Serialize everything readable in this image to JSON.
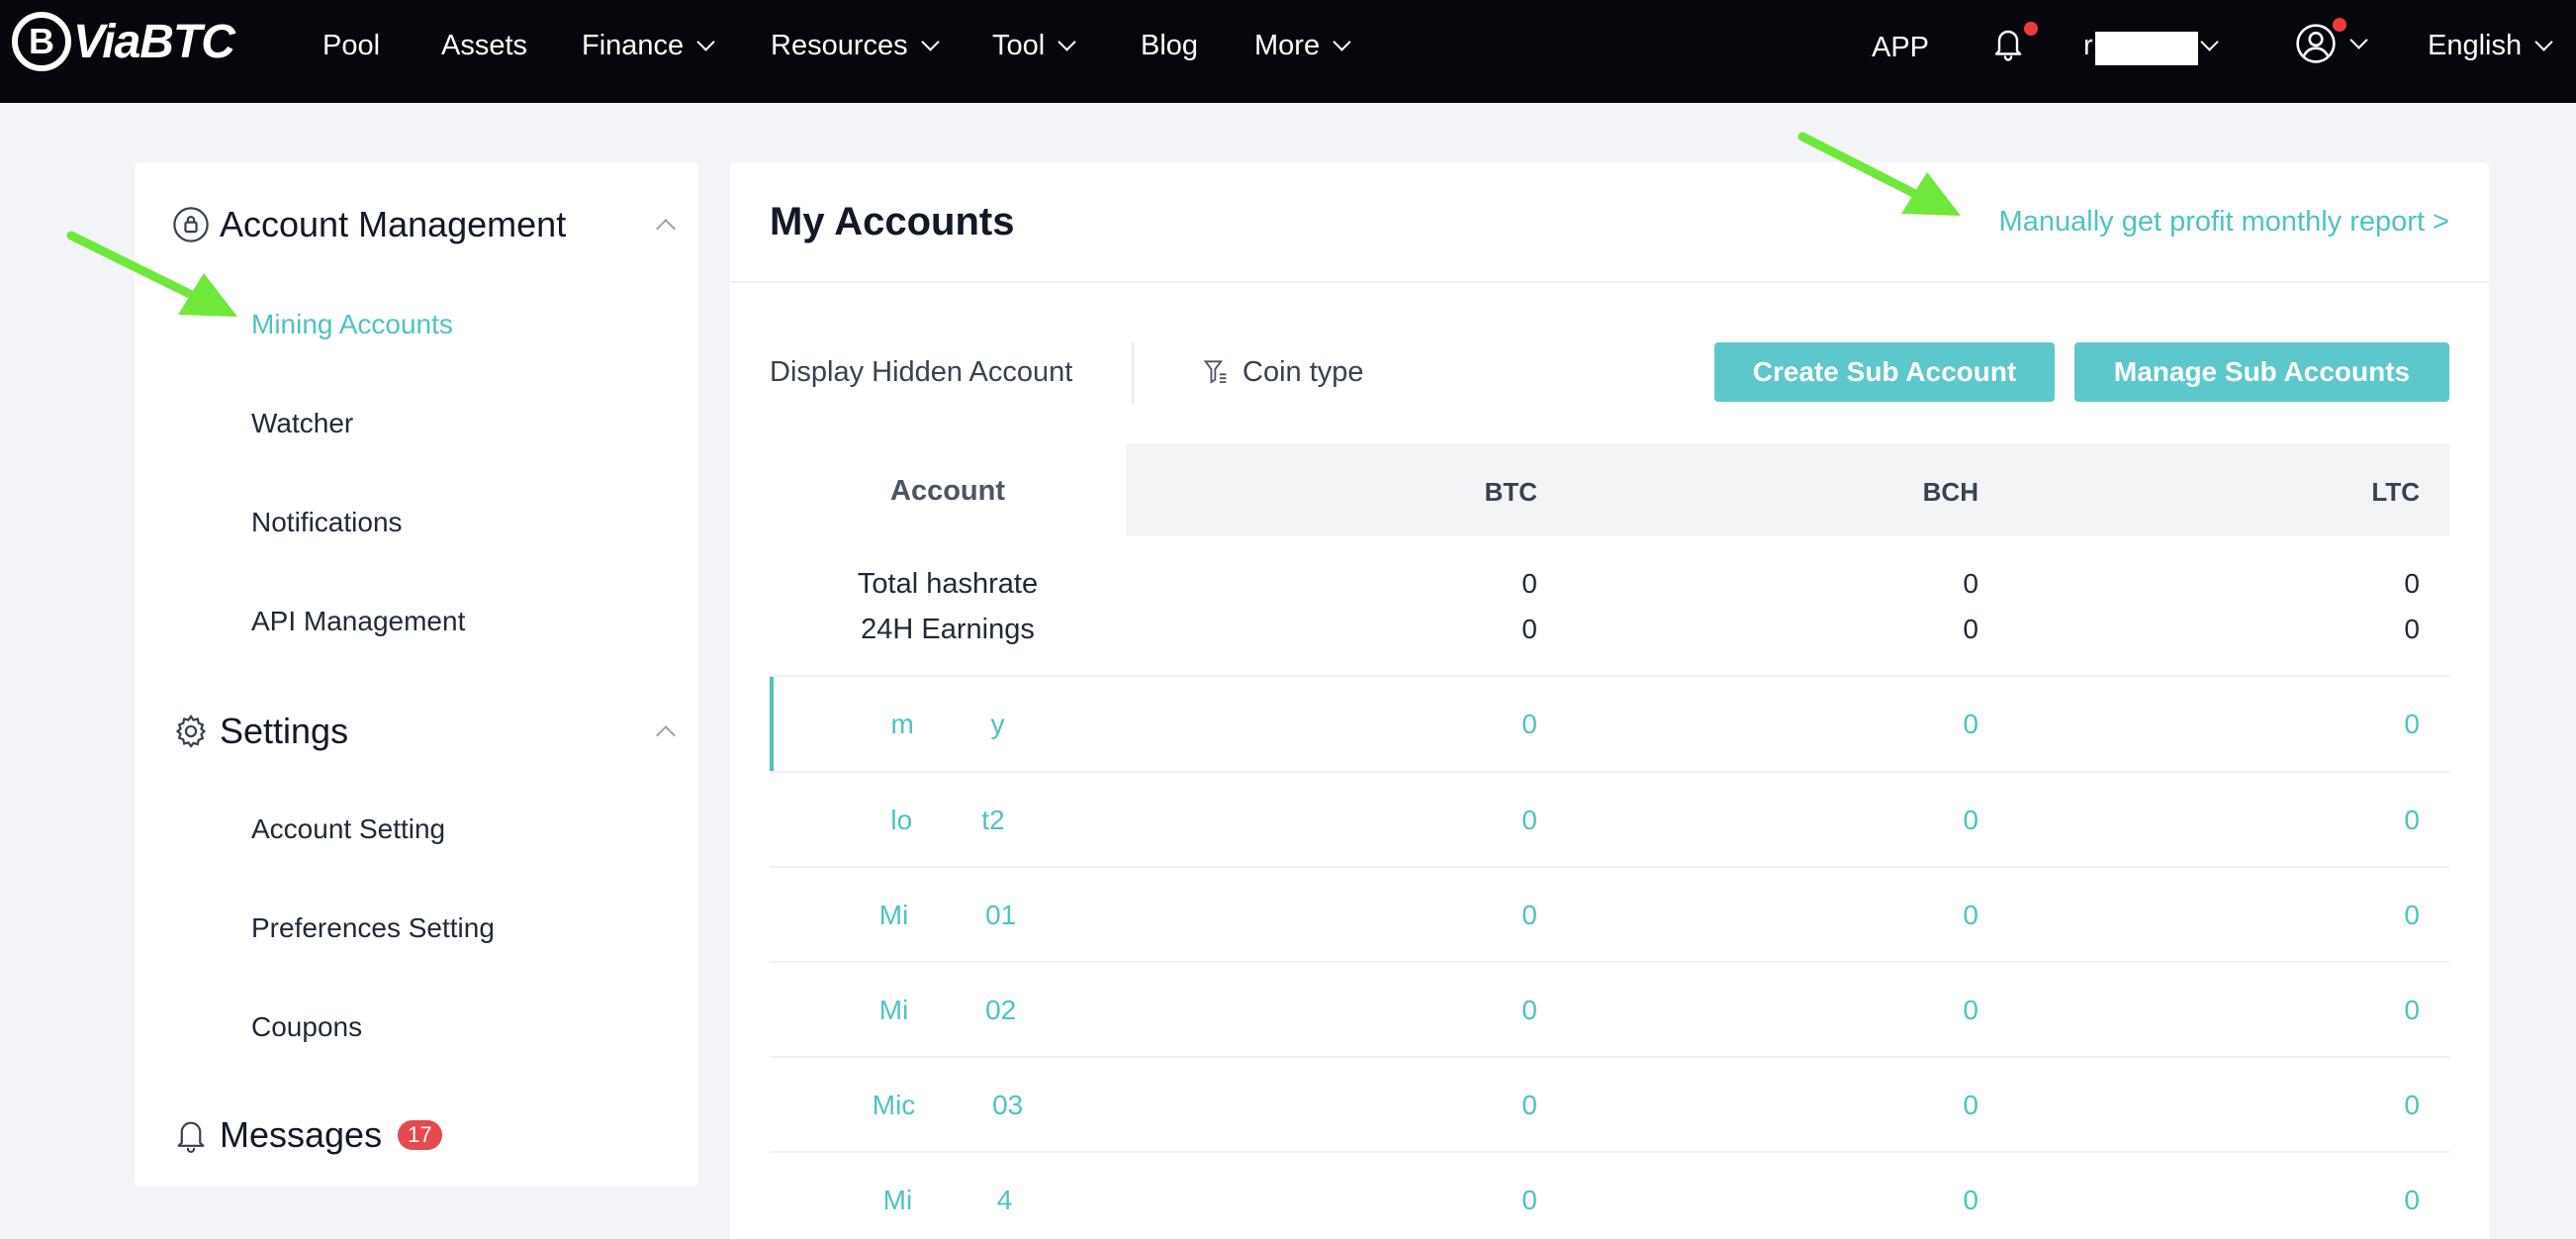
{
  "brand": {
    "logo_text": "ViaBTC",
    "logo_mark": "B"
  },
  "nav": {
    "items": [
      {
        "label": "Pool"
      },
      {
        "label": "Assets"
      },
      {
        "label": "Finance"
      },
      {
        "label": "Resources"
      },
      {
        "label": "Tool"
      },
      {
        "label": "Blog"
      },
      {
        "label": "More"
      }
    ],
    "app": "APP",
    "username": "r          y",
    "language": "English",
    "icons": [
      "bell-icon",
      "user-circle-icon"
    ]
  },
  "sidebar": {
    "account_management": {
      "title": "Account Management",
      "items": [
        "Mining Accounts",
        "Watcher",
        "Notifications",
        "API Management"
      ]
    },
    "settings": {
      "title": "Settings",
      "items": [
        "Account Setting",
        "Preferences Setting",
        "Coupons"
      ]
    },
    "messages": {
      "title": "Messages",
      "count": "17"
    }
  },
  "main": {
    "title": "My Accounts",
    "report_link": "Manually get profit monthly report >",
    "display_hidden": "Display Hidden Account",
    "coin_type": "Coin type",
    "create_button": "Create Sub Account",
    "manage_button": "Manage Sub Accounts",
    "columns": [
      "Account",
      "BTC",
      "BCH",
      "LTC"
    ],
    "summary": [
      {
        "label": "Total hashrate",
        "values": [
          "0",
          "0",
          "0"
        ]
      },
      {
        "label": "24H Earnings",
        "values": [
          "0",
          "0",
          "0"
        ]
      }
    ],
    "rows": [
      {
        "name": "m          y",
        "values": [
          "0",
          "0",
          "0"
        ]
      },
      {
        "name": "lo         t2",
        "values": [
          "0",
          "0",
          "0"
        ]
      },
      {
        "name": "Mi          01",
        "values": [
          "0",
          "0",
          "0"
        ]
      },
      {
        "name": "Mi          02",
        "values": [
          "0",
          "0",
          "0"
        ]
      },
      {
        "name": "Mic          03",
        "values": [
          "0",
          "0",
          "0"
        ]
      },
      {
        "name": "Mi           4",
        "values": [
          "0",
          "0",
          "0"
        ]
      }
    ]
  },
  "colors": {
    "accent": "#4ec3c3",
    "button": "#5cc8cc",
    "nav_bg": "#05070c",
    "badge": "#e5484d",
    "annotation_arrow": "#6ee83a"
  }
}
